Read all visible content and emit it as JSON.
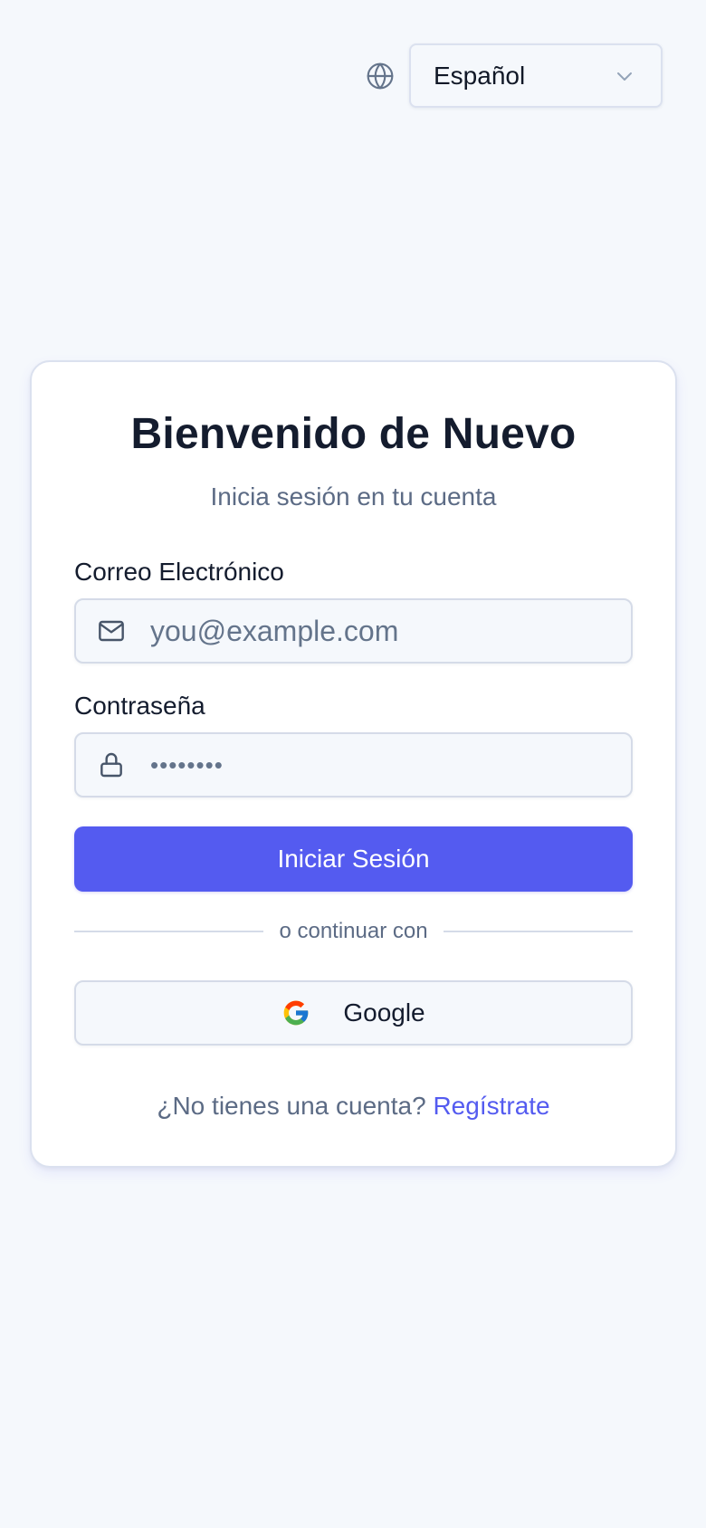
{
  "language": {
    "selected": "Español",
    "icon": "globe-icon"
  },
  "login": {
    "title": "Bienvenido de Nuevo",
    "subtitle": "Inicia sesión en tu cuenta",
    "email": {
      "label": "Correo Electrónico",
      "placeholder": "you@example.com",
      "value": "",
      "icon": "mail-icon"
    },
    "password": {
      "label": "Contraseña",
      "value": "••••••••",
      "icon": "lock-icon"
    },
    "submit_label": "Iniciar Sesión",
    "divider_text": "o continuar con",
    "google_label": "Google",
    "signup_prompt": "¿No tienes una cuenta?",
    "signup_link": "Regístrate"
  },
  "colors": {
    "accent": "#545bf0",
    "background": "#f5f8fc",
    "border": "#d5dbe8",
    "muted_text": "#5c6b85"
  }
}
